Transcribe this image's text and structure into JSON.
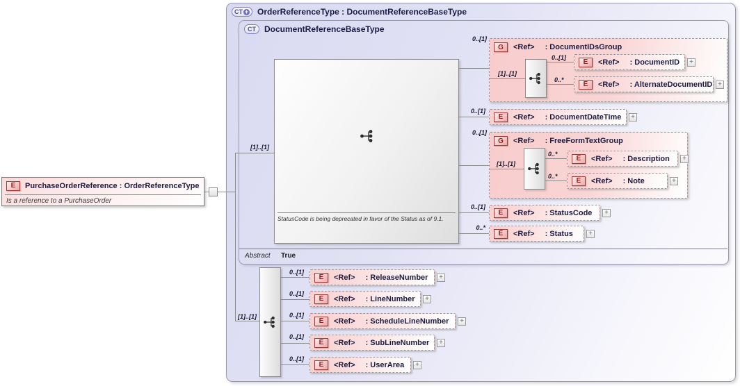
{
  "icons": {
    "element": "E",
    "group": "G",
    "complex_type": "CT",
    "derived_plus": "+",
    "expand": "+"
  },
  "source_element": {
    "title": "PurchaseOrderReference : OrderReferenceType",
    "annotation": "Is a reference to a PurchaseOrder"
  },
  "outer": {
    "title": "OrderReferenceType : DocumentReferenceBaseType"
  },
  "inner": {
    "title": "DocumentReferenceBaseType",
    "abstract_label": "Abstract",
    "abstract_value": "True",
    "deprecation_note": "StatusCode is being deprecated in favor of the Status as of 9.1.",
    "sequence_cardinality": "[1]..[1]"
  },
  "base_children": {
    "document_ids_group": {
      "cardinality": "0..[1]",
      "ref": "<Ref>",
      "name": ": DocumentIDsGroup",
      "seq_cardinality": "[1]..[1]",
      "document_id": {
        "cardinality": "0..[1]",
        "ref": "<Ref>",
        "name": ": DocumentID"
      },
      "alternate_document_id": {
        "cardinality": "0..*",
        "ref": "<Ref>",
        "name": ": AlternateDocumentID"
      }
    },
    "document_date_time": {
      "cardinality": "0..[1]",
      "ref": "<Ref>",
      "name": ": DocumentDateTime"
    },
    "free_form_text_group": {
      "cardinality": "0..[1]",
      "ref": "<Ref>",
      "name": ": FreeFormTextGroup",
      "seq_cardinality": "[1]..[1]",
      "description": {
        "cardinality": "0..*",
        "ref": "<Ref>",
        "name": ": Description"
      },
      "note": {
        "cardinality": "0..*",
        "ref": "<Ref>",
        "name": ": Note"
      }
    },
    "status_code": {
      "cardinality": "0..[1]",
      "ref": "<Ref>",
      "name": ": StatusCode"
    },
    "status": {
      "cardinality": "0..*",
      "ref": "<Ref>",
      "name": ": Status"
    }
  },
  "extension": {
    "sequence_cardinality": "[1]..[1]",
    "release_number": {
      "cardinality": "0..[1]",
      "ref": "<Ref>",
      "name": ": ReleaseNumber"
    },
    "line_number": {
      "cardinality": "0..[1]",
      "ref": "<Ref>",
      "name": ": LineNumber"
    },
    "schedule_line_number": {
      "cardinality": "0..[1]",
      "ref": "<Ref>",
      "name": ": ScheduleLineNumber"
    },
    "sub_line_number": {
      "cardinality": "0..[1]",
      "ref": "<Ref>",
      "name": ": SubLineNumber"
    },
    "user_area": {
      "cardinality": "0..[1]",
      "ref": "<Ref>",
      "name": ": UserArea"
    }
  }
}
